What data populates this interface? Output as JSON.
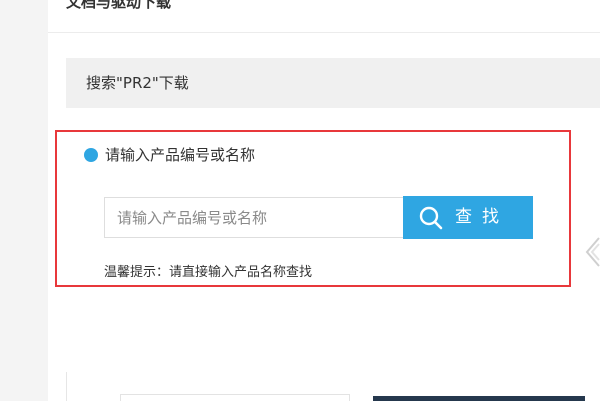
{
  "header": {
    "title": "文档与驱动下载"
  },
  "search_section": {
    "title": "搜索\"PR2\"下载",
    "label": "请输入产品编号或名称",
    "input_placeholder": "请输入产品编号或名称",
    "input_value": "",
    "button_label": "查找",
    "hint": "温馨提示：请直接输入产品名称查找"
  },
  "icons": {
    "button_icon": "search-icon",
    "side_arrow": "chevron-left-icon"
  },
  "colors": {
    "accent": "#2fa6e2",
    "highlight_border": "#e8383b",
    "title_bar_bg": "#f0f0f0"
  }
}
